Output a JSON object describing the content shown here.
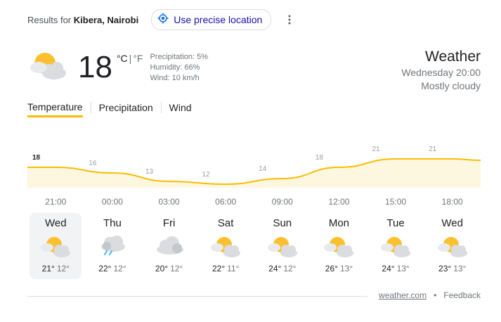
{
  "header": {
    "results_prefix": "Results for",
    "location": "Kibera, Nairobi",
    "precise_location_label": "Use precise location"
  },
  "current": {
    "temperature": "18",
    "unit_c": "°C",
    "unit_f": "°F",
    "precipitation": "Precipitation: 5%",
    "humidity": "Humidity: 66%",
    "wind": "Wind: 10 km/h",
    "icon": "partly-cloudy-icon"
  },
  "panel": {
    "title": "Weather",
    "datetime": "Wednesday 20:00",
    "condition": "Mostly cloudy"
  },
  "tabs": [
    "Temperature",
    "Precipitation",
    "Wind"
  ],
  "active_tab": "Temperature",
  "chart_data": {
    "type": "area",
    "x": [
      "21:00",
      "00:00",
      "03:00",
      "06:00",
      "09:00",
      "12:00",
      "15:00",
      "18:00"
    ],
    "values": [
      18,
      16,
      13,
      12,
      14,
      18,
      21,
      21
    ],
    "labels": [
      "18",
      "16",
      "13",
      "12",
      "14",
      "18",
      "21",
      "21"
    ],
    "line_color": "#fbbc04",
    "fill_color": "#fef7e0"
  },
  "forecast": [
    {
      "day": "Wed",
      "hi": "21°",
      "lo": "12°",
      "icon": "partly-cloudy-icon",
      "selected": true
    },
    {
      "day": "Thu",
      "hi": "22°",
      "lo": "12°",
      "icon": "rain-cloud-icon",
      "selected": false
    },
    {
      "day": "Fri",
      "hi": "20°",
      "lo": "12°",
      "icon": "cloudy-icon",
      "selected": false
    },
    {
      "day": "Sat",
      "hi": "22°",
      "lo": "11°",
      "icon": "partly-cloudy-icon",
      "selected": false
    },
    {
      "day": "Sun",
      "hi": "24°",
      "lo": "12°",
      "icon": "partly-cloudy-icon",
      "selected": false
    },
    {
      "day": "Mon",
      "hi": "26°",
      "lo": "13°",
      "icon": "partly-cloudy-icon",
      "selected": false
    },
    {
      "day": "Tue",
      "hi": "24°",
      "lo": "13°",
      "icon": "partly-cloudy-icon",
      "selected": false
    },
    {
      "day": "Wed",
      "hi": "23°",
      "lo": "13°",
      "icon": "partly-cloudy-icon",
      "selected": false
    }
  ],
  "footer": {
    "source": "weather.com",
    "separator": "•",
    "feedback": "Feedback"
  }
}
